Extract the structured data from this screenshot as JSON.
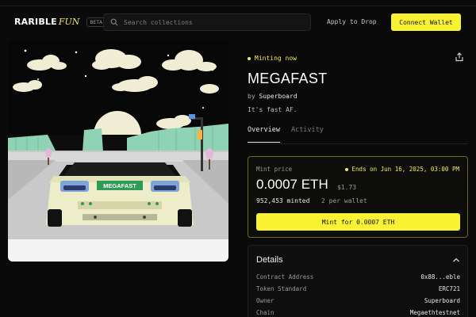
{
  "header": {
    "logo_main": "RARIBLE",
    "logo_fun": "FUN",
    "beta": "BETA",
    "search_placeholder": "Search collections",
    "apply_label": "Apply to Drop",
    "connect_label": "Connect Wallet"
  },
  "artwork": {
    "plate_text": "MEGAFAST"
  },
  "collection": {
    "status": "Minting now",
    "title": "MEGAFAST",
    "by_prefix": "by",
    "creator": "Superboard",
    "description": "It's fast AF."
  },
  "tabs": [
    {
      "label": "Overview",
      "active": true
    },
    {
      "label": "Activity",
      "active": false
    }
  ],
  "mint": {
    "price_label": "Mint price",
    "ends_text": "Ends on Jun 16, 2025, 03:00 PM",
    "price": "0.0007 ETH",
    "usd": "$1.73",
    "minted": "952,453 minted",
    "per_wallet": "2 per wallet",
    "button_label": "Mint for 0.0007 ETH"
  },
  "details": {
    "title": "Details",
    "rows": [
      {
        "key": "Contract Address",
        "value": "0x88...eble"
      },
      {
        "key": "Token Standard",
        "value": "ERC721"
      },
      {
        "key": "Owner",
        "value": "Superboard"
      },
      {
        "key": "Chain",
        "value": "Megaethtestnet"
      }
    ]
  },
  "colors": {
    "accent": "#f8f232",
    "background": "#0a0a0a"
  },
  "icons": [
    "search-icon",
    "share-icon",
    "chevron-up-icon"
  ]
}
